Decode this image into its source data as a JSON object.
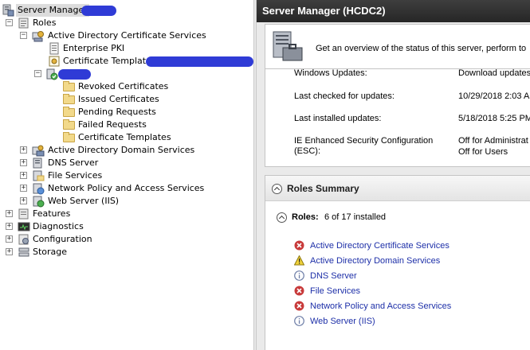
{
  "tree": {
    "root_label": "Server Manager",
    "roles_label": "Roles",
    "adcs_label": "Active Directory Certificate Services",
    "enterprise_pki_label": "Enterprise PKI",
    "cert_templates_label": "Certificate Templates",
    "ca_children": [
      "Revoked Certificates",
      "Issued Certificates",
      "Pending Requests",
      "Failed Requests",
      "Certificate Templates"
    ],
    "other_roles": [
      "Active Directory Domain Services",
      "DNS Server",
      "File Services",
      "Network Policy and Access Services",
      "Web Server (IIS)"
    ],
    "top_nodes": [
      "Features",
      "Diagnostics",
      "Configuration",
      "Storage"
    ],
    "expanded_symbol": "−",
    "collapsed_symbol": "+"
  },
  "right": {
    "header_title": "Server Manager (HCDC2)",
    "overview_text": "Get an overview of the status of this server, perform to",
    "updates": [
      {
        "label": "Windows Updates:",
        "value": "Download updates"
      },
      {
        "label": "Last checked for updates:",
        "value": "10/29/2018 2:03 A"
      },
      {
        "label": "Last installed updates:",
        "value": "5/18/2018 5:25 PM"
      },
      {
        "label": "IE Enhanced Security Configuration",
        "label2": "(ESC):",
        "value": "Off for Administrat",
        "value2": "Off for Users"
      }
    ],
    "roles_summary_title": "Roles Summary",
    "roles_label": "Roles:",
    "roles_count": "6 of 17 installed",
    "roles": [
      {
        "name": "Active Directory Certificate Services",
        "status": "error"
      },
      {
        "name": "Active Directory Domain Services",
        "status": "warning"
      },
      {
        "name": "DNS Server",
        "status": "info"
      },
      {
        "name": "File Services",
        "status": "error"
      },
      {
        "name": "Network Policy and Access Services",
        "status": "error"
      },
      {
        "name": "Web Server (IIS)",
        "status": "info"
      }
    ]
  },
  "colors": {
    "redaction": "#2f3bd6",
    "error": "#c83a3a",
    "warning": "#f0d23a",
    "info": "#6f7fa8",
    "link": "#1d2fa8"
  }
}
